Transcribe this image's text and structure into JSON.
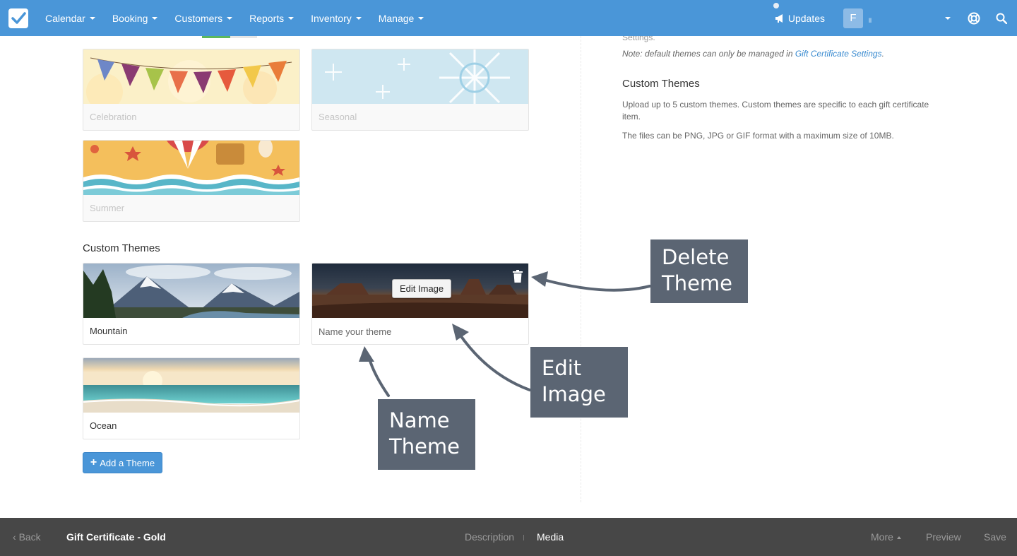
{
  "nav": {
    "items": [
      {
        "label": "Calendar"
      },
      {
        "label": "Booking"
      },
      {
        "label": "Customers"
      },
      {
        "label": "Reports"
      },
      {
        "label": "Inventory"
      },
      {
        "label": "Manage"
      }
    ],
    "updates_label": "Updates",
    "avatar_initial": "F",
    "username": "ll"
  },
  "default_themes": [
    {
      "label": "Celebration"
    },
    {
      "label": "Seasonal"
    },
    {
      "label": "Summer"
    }
  ],
  "custom_section_title": "Custom Themes",
  "custom_themes": [
    {
      "label": "Mountain"
    },
    {
      "placeholder": "Name your theme",
      "edit_label": "Edit Image"
    },
    {
      "label": "Ocean"
    }
  ],
  "add_theme_label": "Add a Theme",
  "sidebar": {
    "cut_text": "Settings.",
    "note_prefix": "Note: default themes can only be managed in",
    "note_link": "Gift Certificate Settings",
    "note_suffix": ".",
    "heading": "Custom Themes",
    "paragraph1": "Upload up to 5 custom themes. Custom themes are specific to each gift certificate item.",
    "paragraph2": "The files can be PNG, JPG or GIF format with a maximum size of 10MB."
  },
  "callouts": {
    "delete": {
      "line1": "Delete",
      "line2": "Theme"
    },
    "edit": {
      "line1": "Edit",
      "line2": "Image"
    },
    "name": {
      "line1": "Name",
      "line2": "Theme"
    }
  },
  "bottombar": {
    "back": "Back",
    "title": "Gift Certificate - Gold",
    "tab_description": "Description",
    "tab_media": "Media",
    "more": "More",
    "preview": "Preview",
    "save": "Save"
  },
  "colors": {
    "nav_bg": "#4a96d8",
    "callout_bg": "#5b6573",
    "bottombar_bg": "#474747",
    "link": "#3a8bd0"
  }
}
